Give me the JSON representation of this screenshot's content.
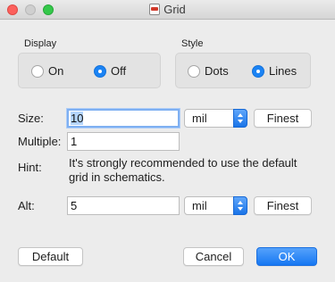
{
  "window": {
    "title": "Grid"
  },
  "display": {
    "label": "Display",
    "options": [
      {
        "label": "On",
        "selected": false
      },
      {
        "label": "Off",
        "selected": true
      }
    ]
  },
  "style": {
    "label": "Style",
    "options": [
      {
        "label": "Dots",
        "selected": false
      },
      {
        "label": "Lines",
        "selected": true
      }
    ]
  },
  "size": {
    "label": "Size:",
    "value": "10",
    "unit": "mil",
    "button": "Finest"
  },
  "multiple": {
    "label": "Multiple:",
    "value": "1"
  },
  "hint": {
    "label": "Hint:",
    "text": "It's strongly recommended to use the default grid in schematics."
  },
  "alt": {
    "label": "Alt:",
    "value": "5",
    "unit": "mil",
    "button": "Finest"
  },
  "footer": {
    "default_label": "Default",
    "cancel_label": "Cancel",
    "ok_label": "OK"
  },
  "colors": {
    "accent": "#1b83f4",
    "close": "#fc605c",
    "maximize": "#34c84a"
  }
}
